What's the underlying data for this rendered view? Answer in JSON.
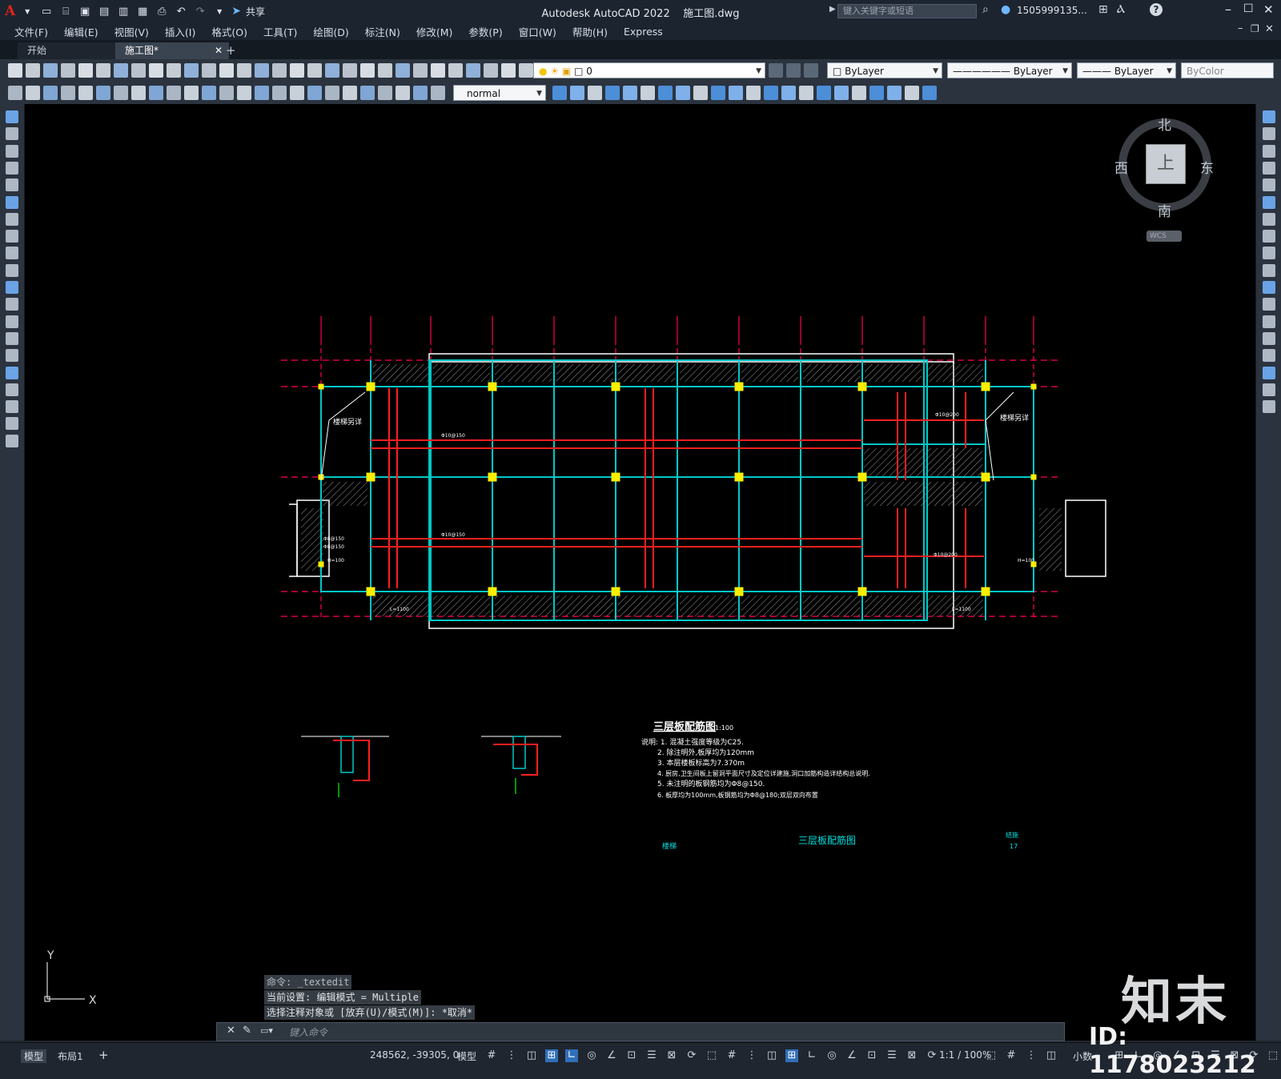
{
  "titlebar": {
    "app_title": "Autodesk AutoCAD 2022",
    "filename": "施工图.dwg",
    "share_label": "共享",
    "search_placeholder": "键入关键字或短语",
    "user": "1505999135...",
    "logo": "A"
  },
  "menu": [
    "文件(F)",
    "编辑(E)",
    "视图(V)",
    "插入(I)",
    "格式(O)",
    "工具(T)",
    "绘图(D)",
    "标注(N)",
    "修改(M)",
    "参数(P)",
    "窗口(W)",
    "帮助(H)",
    "Express"
  ],
  "tabs": [
    {
      "label": "开始",
      "active": false
    },
    {
      "label": "施工图*",
      "active": true
    }
  ],
  "toolbar": {
    "layer_value": "0",
    "color_value": "ByLayer",
    "linetype_value": "ByLayer",
    "lineweight_value": "ByLayer",
    "plotstyle_value": "ByColor",
    "textstyle_value": "normal"
  },
  "viewcube": {
    "north": "北",
    "south": "南",
    "east": "东",
    "west": "西",
    "face": "上",
    "wcs": "WCS"
  },
  "drawing": {
    "title": "三层板配筋图",
    "scale": "1:100",
    "notes": [
      "说明: 1. 混凝土强度等级为C25.",
      "2. 除注明外,板厚均为120mm",
      "3. 本层楼板标高为7.370m",
      "4. 厨房,卫生间板上留洞平面尺寸及定位详建施,洞口加筋构造详结构总说明.",
      "5. 未注明的板钢筋均为Φ8@150.",
      "6. 板厚均为100mm,板钢筋均为Φ8@180;双层双向布置"
    ],
    "footer_label": "三层板配筋图",
    "footer_left": "楼梯",
    "footer_right_top": "结施",
    "footer_right_bottom": "17",
    "stair_label": "楼梯另详",
    "rebar_a": "Φ10@150",
    "rebar_b": "Φ8@150",
    "rebar_c": "Φ10@200",
    "h_label": "H=100",
    "l_label": "L=1100"
  },
  "ucs": {
    "x": "X",
    "y": "Y"
  },
  "command": {
    "history": [
      "命令: _textedit",
      "当前设置: 编辑模式 = Multiple",
      "选择注释对象或 [放弃(U)/模式(M)]: *取消*"
    ],
    "placeholder": "键入命令"
  },
  "status": {
    "layout_tabs": [
      "模型",
      "布局1"
    ],
    "coords": "248562, -39305, 0",
    "mode": "模型",
    "scale": "1:1 / 100%",
    "units": "小数"
  },
  "watermark": {
    "brand": "知末",
    "id": "ID: 1178023212"
  },
  "colors": {
    "canvas": "#000000",
    "beam": "#00c8c8",
    "rebar": "#ff2020",
    "axis": "#ff0050",
    "column": "#ffee00",
    "outline": "#ffffff"
  }
}
